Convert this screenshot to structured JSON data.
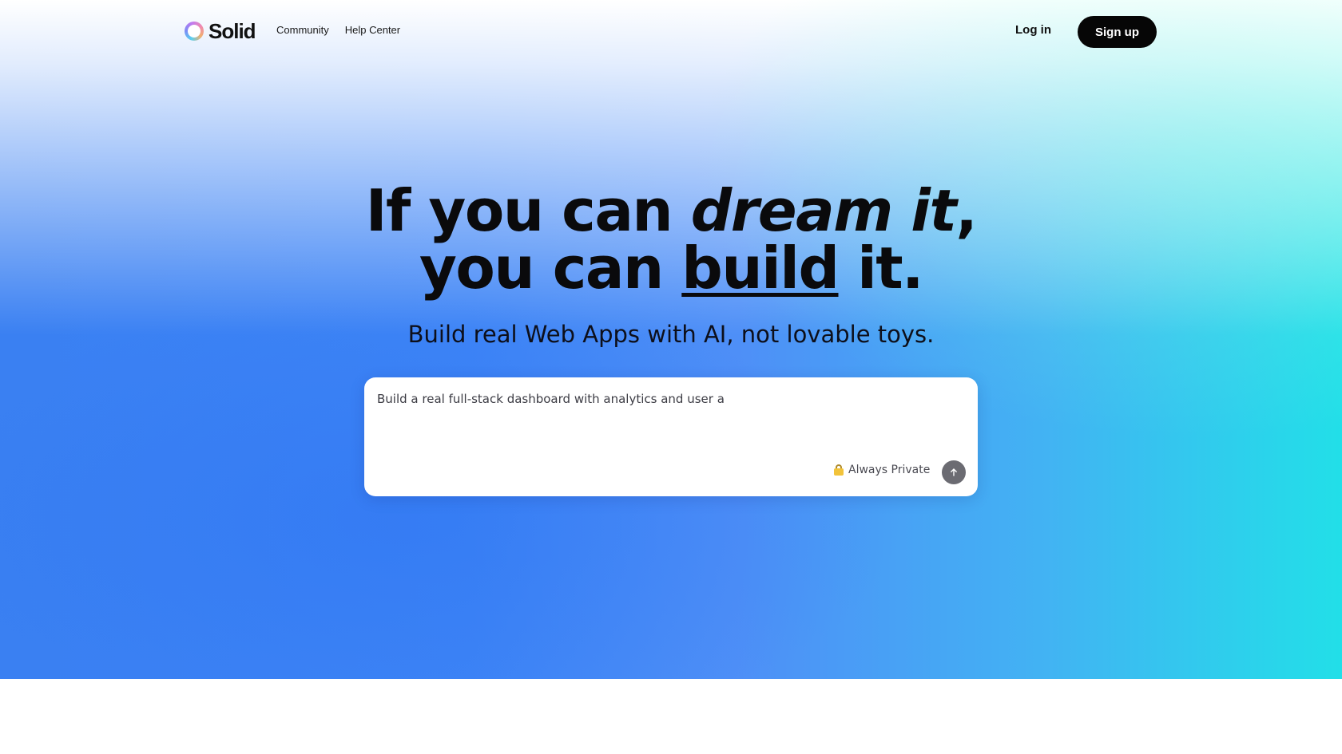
{
  "header": {
    "brand": "Solid",
    "nav": [
      {
        "label": "Community"
      },
      {
        "label": "Help Center"
      }
    ],
    "login_label": "Log in",
    "signup_label": "Sign up"
  },
  "hero": {
    "headline_line1_prefix": "If you can ",
    "headline_line1_emphasis": "dream it",
    "headline_line1_suffix": ",",
    "headline_line2_prefix": "you can ",
    "headline_line2_underline": "build",
    "headline_line2_suffix": " it.",
    "subheadline": "Build real Web Apps with AI, not lovable toys."
  },
  "prompt": {
    "value": "Build a real full-stack dashboard with analytics and user a",
    "privacy_label": "Always Private"
  },
  "icons": {
    "brand": "solid-logo-icon",
    "privacy": "lock-icon",
    "send": "arrow-up-icon"
  },
  "colors": {
    "signup_bg": "#060606",
    "send_bg": "#6b6b72",
    "gradient_left": "#3a80f2",
    "gradient_right": "#22dfe8"
  }
}
